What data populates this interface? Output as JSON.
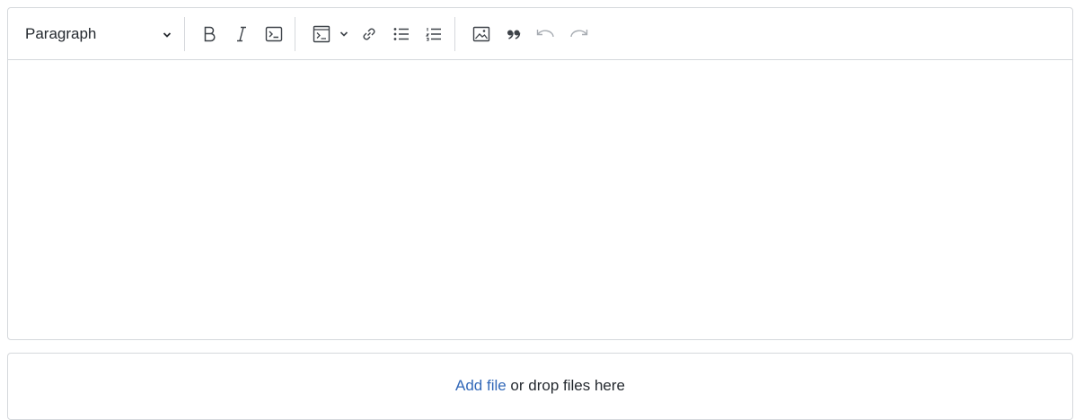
{
  "editor": {
    "format_select": {
      "value": "Paragraph",
      "icon": "chevron-down-icon"
    },
    "toolbar": [
      {
        "name": "bold-button",
        "icon": "bold-icon",
        "enabled": true
      },
      {
        "name": "italic-button",
        "icon": "italic-icon",
        "enabled": true
      },
      {
        "name": "inline-code-button",
        "icon": "code-icon",
        "enabled": true
      },
      {
        "name": "code-block-button",
        "icon": "code-block-icon",
        "enabled": true
      },
      {
        "name": "link-button",
        "icon": "link-icon",
        "enabled": true
      },
      {
        "name": "bulleted-list-button",
        "icon": "bulleted-list-icon",
        "enabled": true
      },
      {
        "name": "numbered-list-button",
        "icon": "numbered-list-icon",
        "enabled": true
      },
      {
        "name": "image-button",
        "icon": "image-icon",
        "enabled": true
      },
      {
        "name": "blockquote-button",
        "icon": "quote-icon",
        "enabled": true
      },
      {
        "name": "undo-button",
        "icon": "undo-icon",
        "enabled": false
      },
      {
        "name": "redo-button",
        "icon": "redo-icon",
        "enabled": false
      }
    ],
    "content": ""
  },
  "dropzone": {
    "link_label": "Add file",
    "suffix": " or drop files here"
  },
  "colors": {
    "link": "#3268b8",
    "border": "#d5d8dc",
    "icon": "#3d4248",
    "icon_disabled": "#a8adb3"
  }
}
